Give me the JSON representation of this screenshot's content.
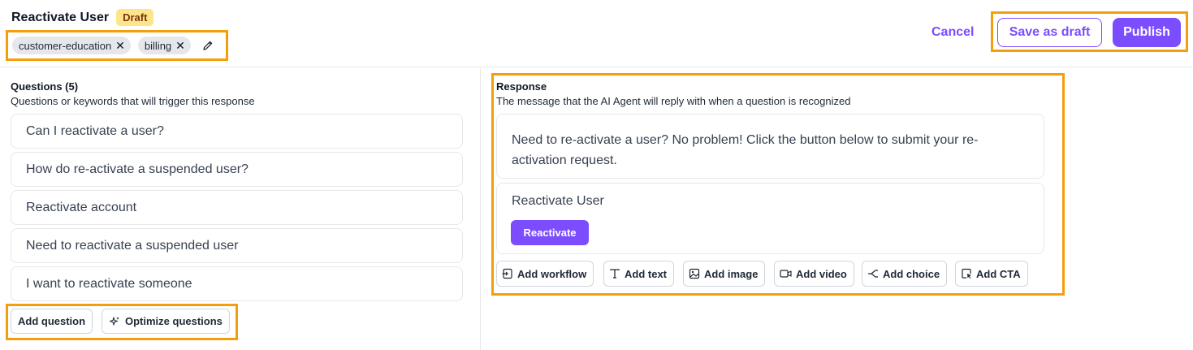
{
  "header": {
    "title": "Reactivate User",
    "status_badge": "Draft",
    "tags": [
      {
        "label": "customer-education"
      },
      {
        "label": "billing"
      }
    ],
    "cancel_label": "Cancel",
    "save_draft_label": "Save as draft",
    "publish_label": "Publish"
  },
  "questions": {
    "title": "Questions (5)",
    "subtitle": "Questions or keywords that will trigger this response",
    "items": [
      "Can I reactivate a user?",
      "How do re-activate a suspended user?",
      "Reactivate account",
      "Need to reactivate a suspended user",
      "I want to reactivate someone"
    ],
    "add_label": "Add question",
    "optimize_label": "Optimize questions"
  },
  "response": {
    "title": "Response",
    "subtitle": "The message that the AI Agent will reply with when a question is recognized",
    "message_line1": "Need to re-activate a user? No problem! Click the button below to submit your re-",
    "message_line2": "activation request.",
    "cta_title": "Reactivate User",
    "cta_button": "Reactivate",
    "tools": [
      {
        "label": "Add workflow",
        "icon": "workflow-icon"
      },
      {
        "label": "Add text",
        "icon": "text-icon"
      },
      {
        "label": "Add image",
        "icon": "image-icon"
      },
      {
        "label": "Add video",
        "icon": "video-icon"
      },
      {
        "label": "Add choice",
        "icon": "choice-icon"
      },
      {
        "label": "Add CTA",
        "icon": "cta-icon"
      }
    ]
  },
  "colors": {
    "accent": "#7c4dff",
    "highlight": "#f59e0b",
    "badge_bg": "#fde68a"
  }
}
